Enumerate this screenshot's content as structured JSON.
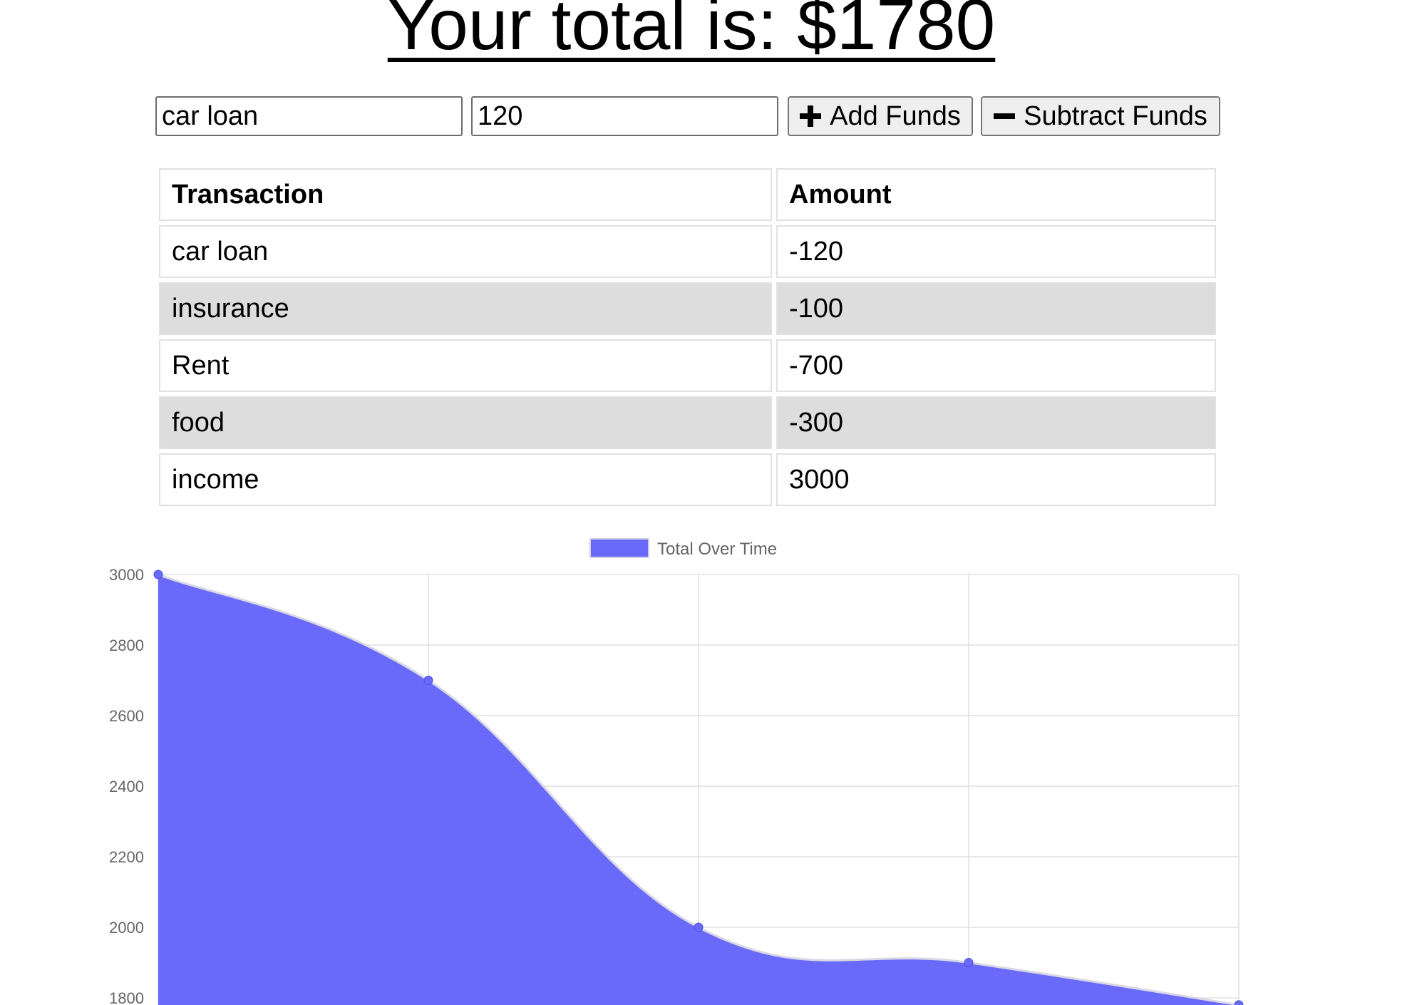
{
  "header": {
    "title": "Your total is: $1780"
  },
  "form": {
    "name_value": "car loan",
    "amount_value": "120",
    "add_label": "Add Funds",
    "subtract_label": "Subtract Funds"
  },
  "table": {
    "headers": [
      "Transaction",
      "Amount"
    ],
    "rows": [
      {
        "name": "car loan",
        "amount": "-120"
      },
      {
        "name": "insurance",
        "amount": "-100"
      },
      {
        "name": "Rent",
        "amount": "-700"
      },
      {
        "name": "food",
        "amount": "-300"
      },
      {
        "name": "income",
        "amount": "3000"
      }
    ]
  },
  "colors": {
    "series_fill": "#6969fa",
    "grid": "#e0e0e0",
    "zebra": "#dddddd"
  },
  "chart_data": {
    "type": "area",
    "legend_position": "top",
    "grid": true,
    "series": [
      {
        "name": "Total Over Time",
        "values": [
          3000,
          2700,
          2000,
          1900,
          1780
        ]
      }
    ],
    "y_ticks": [
      3000,
      2800,
      2600,
      2400,
      2200,
      2000,
      1800
    ],
    "ylim": [
      1780,
      3000
    ]
  }
}
